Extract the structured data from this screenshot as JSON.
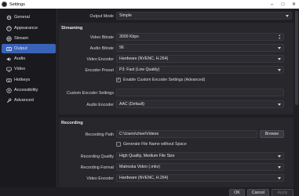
{
  "window": {
    "title": "Settings"
  },
  "sidebar": {
    "items": [
      {
        "label": "General",
        "icon": "gear-icon"
      },
      {
        "label": "Appearance",
        "icon": "palette-icon"
      },
      {
        "label": "Stream",
        "icon": "globe-icon"
      },
      {
        "label": "Output",
        "icon": "output-icon",
        "active": true
      },
      {
        "label": "Audio",
        "icon": "speaker-icon"
      },
      {
        "label": "Video",
        "icon": "monitor-icon"
      },
      {
        "label": "Hotkeys",
        "icon": "keyboard-icon"
      },
      {
        "label": "Accessibility",
        "icon": "accessibility-icon"
      },
      {
        "label": "Advanced",
        "icon": "wrench-icon"
      }
    ]
  },
  "output_mode": {
    "label": "Output Mode",
    "value": "Simple"
  },
  "streaming": {
    "title": "Streaming",
    "video_bitrate": {
      "label": "Video Bitrate",
      "value": "3000 Kbps"
    },
    "audio_bitrate": {
      "label": "Audio Bitrate",
      "value": "96"
    },
    "video_encoder": {
      "label": "Video Encoder",
      "value": "Hardware (NVENC, H.264)"
    },
    "encoder_preset": {
      "label": "Encoder Preset",
      "value": "P3: Fast (Low Quality)"
    },
    "custom_checkbox": {
      "label": "Enable Custom Encoder Settings (Advanced)",
      "checked": true
    },
    "custom_settings": {
      "label": "Custom Encoder Settings",
      "value": ""
    },
    "audio_encoder": {
      "label": "Audio Encoder",
      "value": "AAC (Default)"
    }
  },
  "recording": {
    "title": "Recording",
    "path": {
      "label": "Recording Path",
      "value": "C:\\Users\\chee\\Videos",
      "browse": "Browse"
    },
    "no_space": {
      "label": "Generate File Name without Space",
      "checked": false
    },
    "quality": {
      "label": "Recording Quality",
      "value": "High Quality, Medium File Size"
    },
    "format": {
      "label": "Recording Format",
      "value": "Matroska Video (.mkv)"
    },
    "video_encoder": {
      "label": "Video Encoder",
      "value": "Hardware (NVENC, H.264)"
    }
  },
  "footer": {
    "ok": "OK",
    "cancel": "Cancel",
    "apply": "Apply"
  }
}
